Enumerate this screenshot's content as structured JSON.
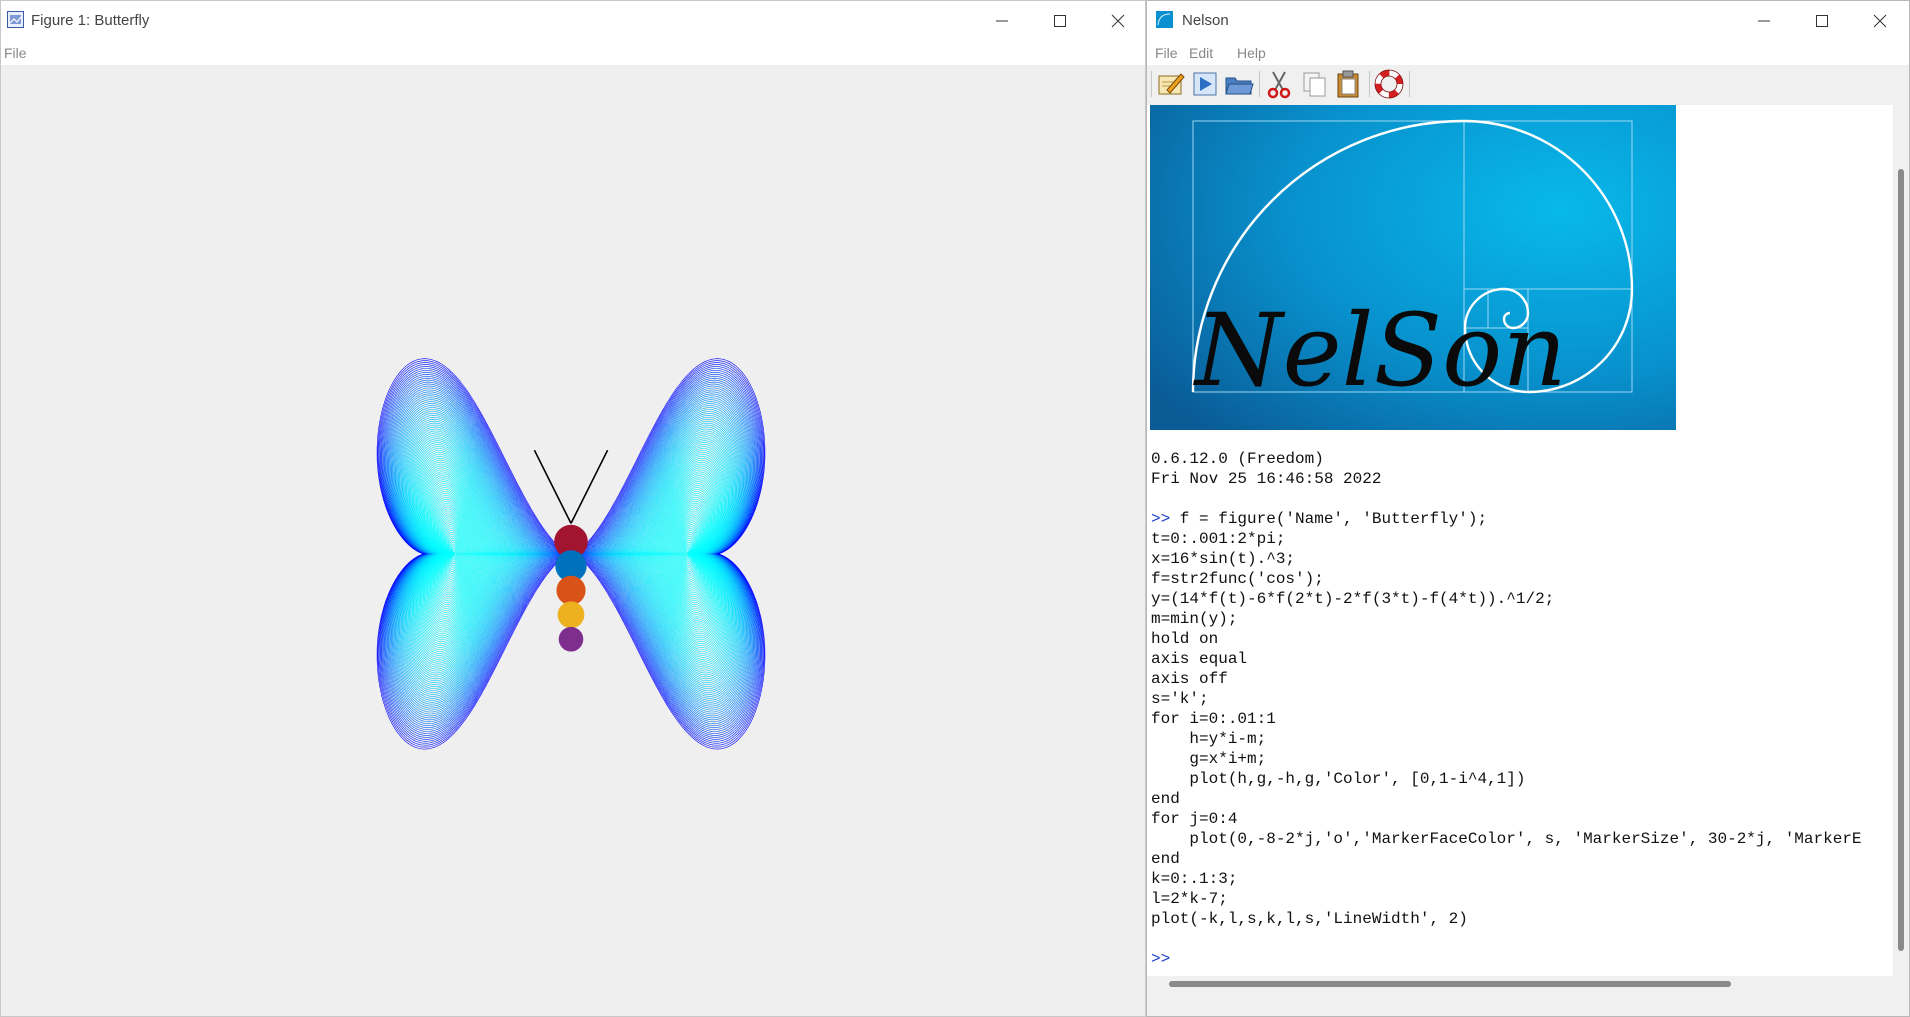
{
  "figure_window": {
    "title": "Figure 1: Butterfly",
    "menu": [
      "File"
    ],
    "controls": [
      "minimize-icon",
      "maximize-icon",
      "close-icon"
    ]
  },
  "butterfly": {
    "line_color": "#000000",
    "body_dot_colors": [
      "#a2142f",
      "#0072bd",
      "#d95319",
      "#edb120",
      "#7e2f8e"
    ]
  },
  "nelson_window": {
    "title": "Nelson",
    "menu": [
      "File",
      "Edit",
      "Help"
    ],
    "toolbar": [
      "editor-icon",
      "run-icon",
      "open-folder-icon",
      "cut-icon",
      "copy-icon",
      "paste-icon",
      "help-lifebuoy-icon"
    ],
    "logo_text": "NelSon",
    "console": {
      "version": "0.6.12.0 (Freedom)",
      "date": "Fri Nov 25 16:46:58 2022",
      "prompt": ">>",
      "first_command": " f = figure('Name', 'Butterfly');",
      "script_lines": [
        "t=0:.001:2*pi;",
        "x=16*sin(t).^3;",
        "f=str2func('cos');",
        "y=(14*f(t)-6*f(2*t)-2*f(3*t)-f(4*t)).^1/2;",
        "m=min(y);",
        "hold on",
        "axis equal",
        "axis off",
        "s='k';",
        "for i=0:.01:1",
        "    h=y*i-m;",
        "    g=x*i+m;",
        "    plot(h,g,-h,g,'Color', [0,1-i^4,1])",
        "end",
        "for j=0:4",
        "    plot(0,-8-2*j,'o','MarkerFaceColor', s, 'MarkerSize', 30-2*j, 'MarkerE",
        "end",
        "k=0:.1:3;",
        "l=2*k-7;",
        "plot(-k,l,s,k,l,s,'LineWidth', 2)"
      ],
      "final_prompt": ">>"
    }
  }
}
